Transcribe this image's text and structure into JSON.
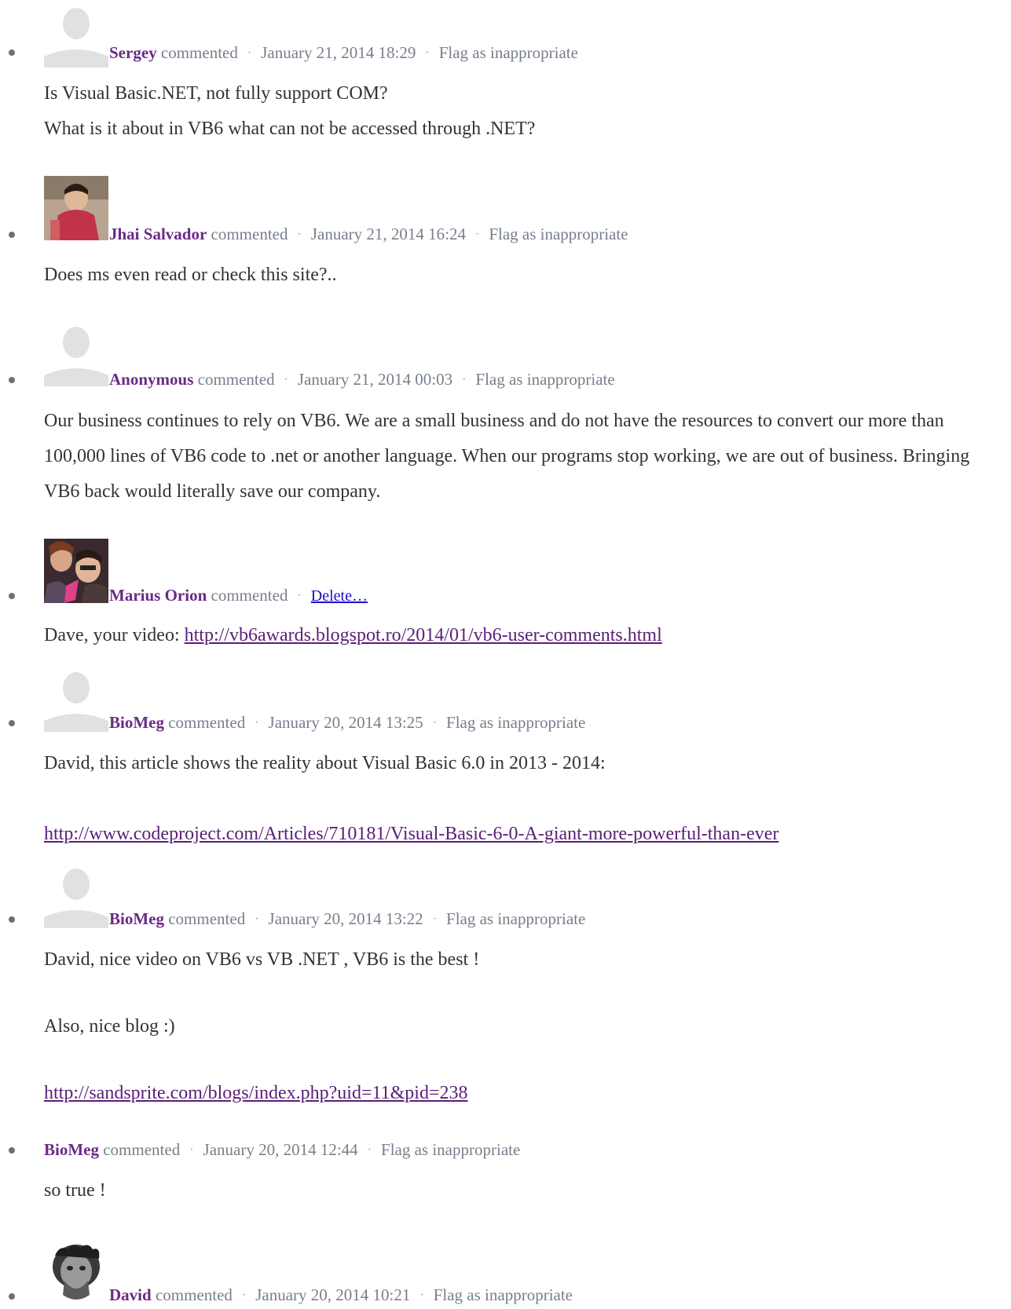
{
  "comments": [
    {
      "author": "Sergey",
      "verb": "commented",
      "date": "January 21, 2014 18:29",
      "action": "Flag as inappropriate",
      "body": [
        "Is Visual Basic.NET, not fully support COM?",
        "What is it about in VB6 what can not be accessed through .NET?"
      ]
    },
    {
      "author": "Jhai Salvador",
      "verb": "commented",
      "date": "January 21, 2014 16:24",
      "action": "Flag as inappropriate",
      "body": [
        "Does ms even read or check this site?.."
      ]
    },
    {
      "author": "Anonymous",
      "verb": "commented",
      "date": "January 21, 2014 00:03",
      "action": "Flag as inappropriate",
      "body": [
        "Our business continues to rely on VB6. We are a small business and do not have the resources to convert our more than 100,000 lines of VB6 code to .net or another language. When our programs stop working, we are out of business. Bringing VB6 back would literally save our company."
      ]
    },
    {
      "author": "Marius Orion",
      "verb": "commented",
      "action": "Delete…",
      "body_prefix": "Dave, your video: ",
      "body_link": "http://vb6awards.blogspot.ro/2014/01/vb6-user-comments.html"
    },
    {
      "author": "BioMeg",
      "verb": "commented",
      "date": "January 20, 2014 13:25",
      "action": "Flag as inappropriate",
      "body": [
        "David, this article shows the reality about Visual Basic 6.0 in 2013 - 2014:"
      ],
      "body_link": "http://www.codeproject.com/Articles/710181/Visual-Basic-6-0-A-giant-more-powerful-than-ever"
    },
    {
      "author": "BioMeg",
      "verb": "commented",
      "date": "January 20, 2014 13:22",
      "action": "Flag as inappropriate",
      "body": [
        "David, nice video on VB6 vs VB .NET , VB6 is the best !",
        "Also, nice blog :)"
      ],
      "body_link": "http://sandsprite.com/blogs/index.php?uid=11&pid=238"
    },
    {
      "author": "BioMeg",
      "verb": "commented",
      "date": "January 20, 2014 12:44",
      "action": "Flag as inappropriate",
      "body": [
        "so true !"
      ]
    },
    {
      "author": "David",
      "verb": "commented",
      "date": "January 20, 2014 10:21",
      "action": "Flag as inappropriate"
    }
  ],
  "icons": {
    "default_avatar": "default-avatar-icon",
    "bullet": "bullet-icon"
  },
  "colors": {
    "author": "#6b2a87",
    "meta": "#777f8c",
    "link": "#5a1e78",
    "delete_link": "#1a0dcc"
  }
}
